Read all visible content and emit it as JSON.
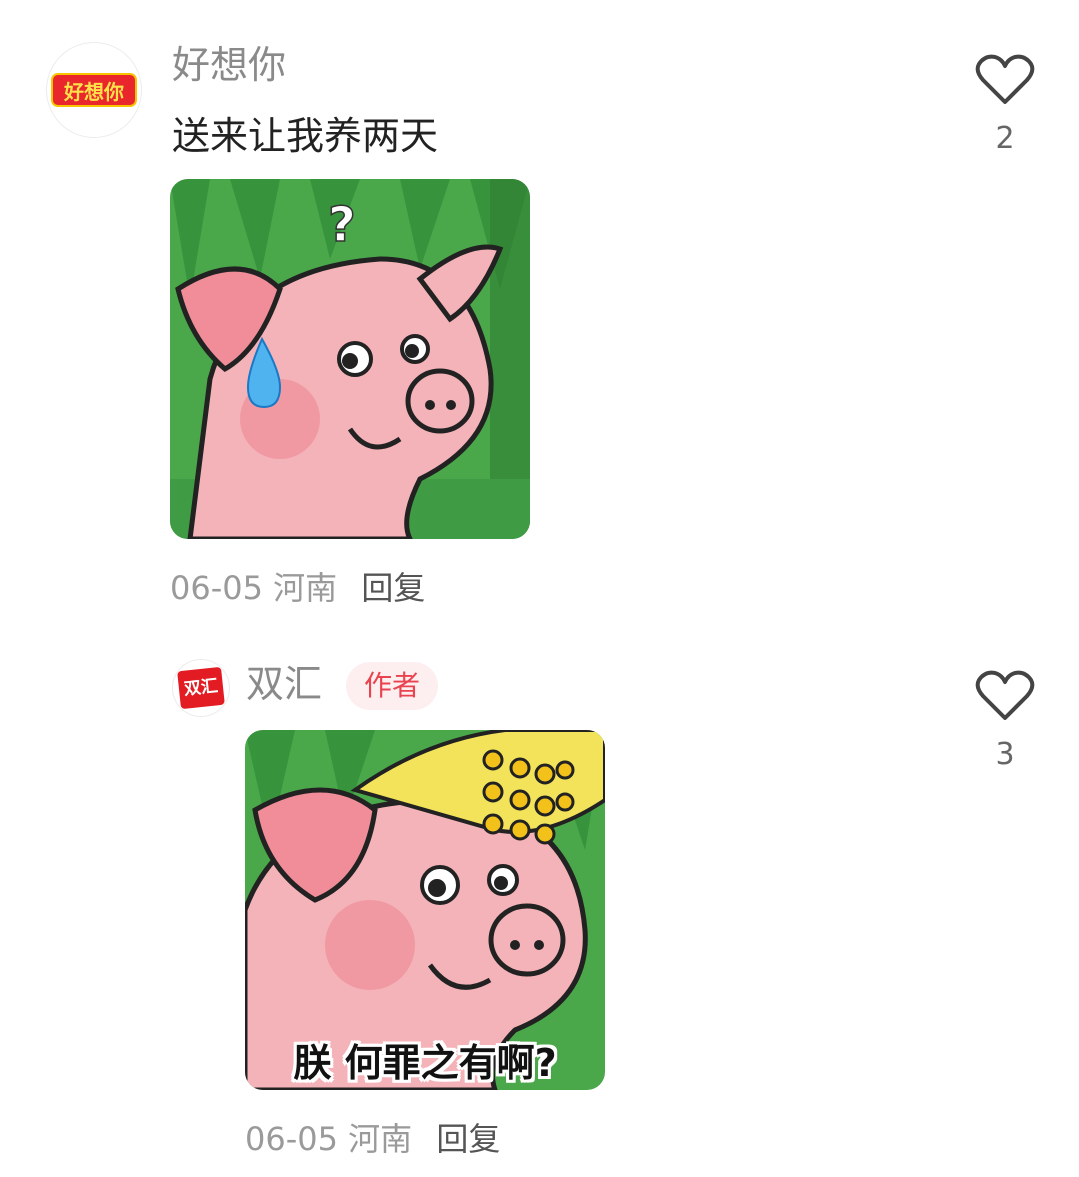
{
  "comments": [
    {
      "avatar_text": "好想你",
      "username": "好想你",
      "text": "送来让我养两天",
      "sticker_caption": "",
      "date": "06-05",
      "location": "河南",
      "reply_label": "回复",
      "likes": "2"
    },
    {
      "avatar_text": "双汇",
      "username": "双汇",
      "author_badge": "作者",
      "sticker_caption": "朕 何罪之有啊?",
      "date": "06-05",
      "location": "河南",
      "reply_label": "回复",
      "likes": "3"
    }
  ],
  "colors": {
    "background": "#ffffff",
    "author_badge_bg": "#fdeef0",
    "author_badge_text": "#e8434f",
    "sticker_green": "#4aa84a",
    "pig_pink": "#f4b3b8"
  },
  "icons": [
    "heart-outline-icon",
    "question-mark",
    "sweat-drop"
  ]
}
